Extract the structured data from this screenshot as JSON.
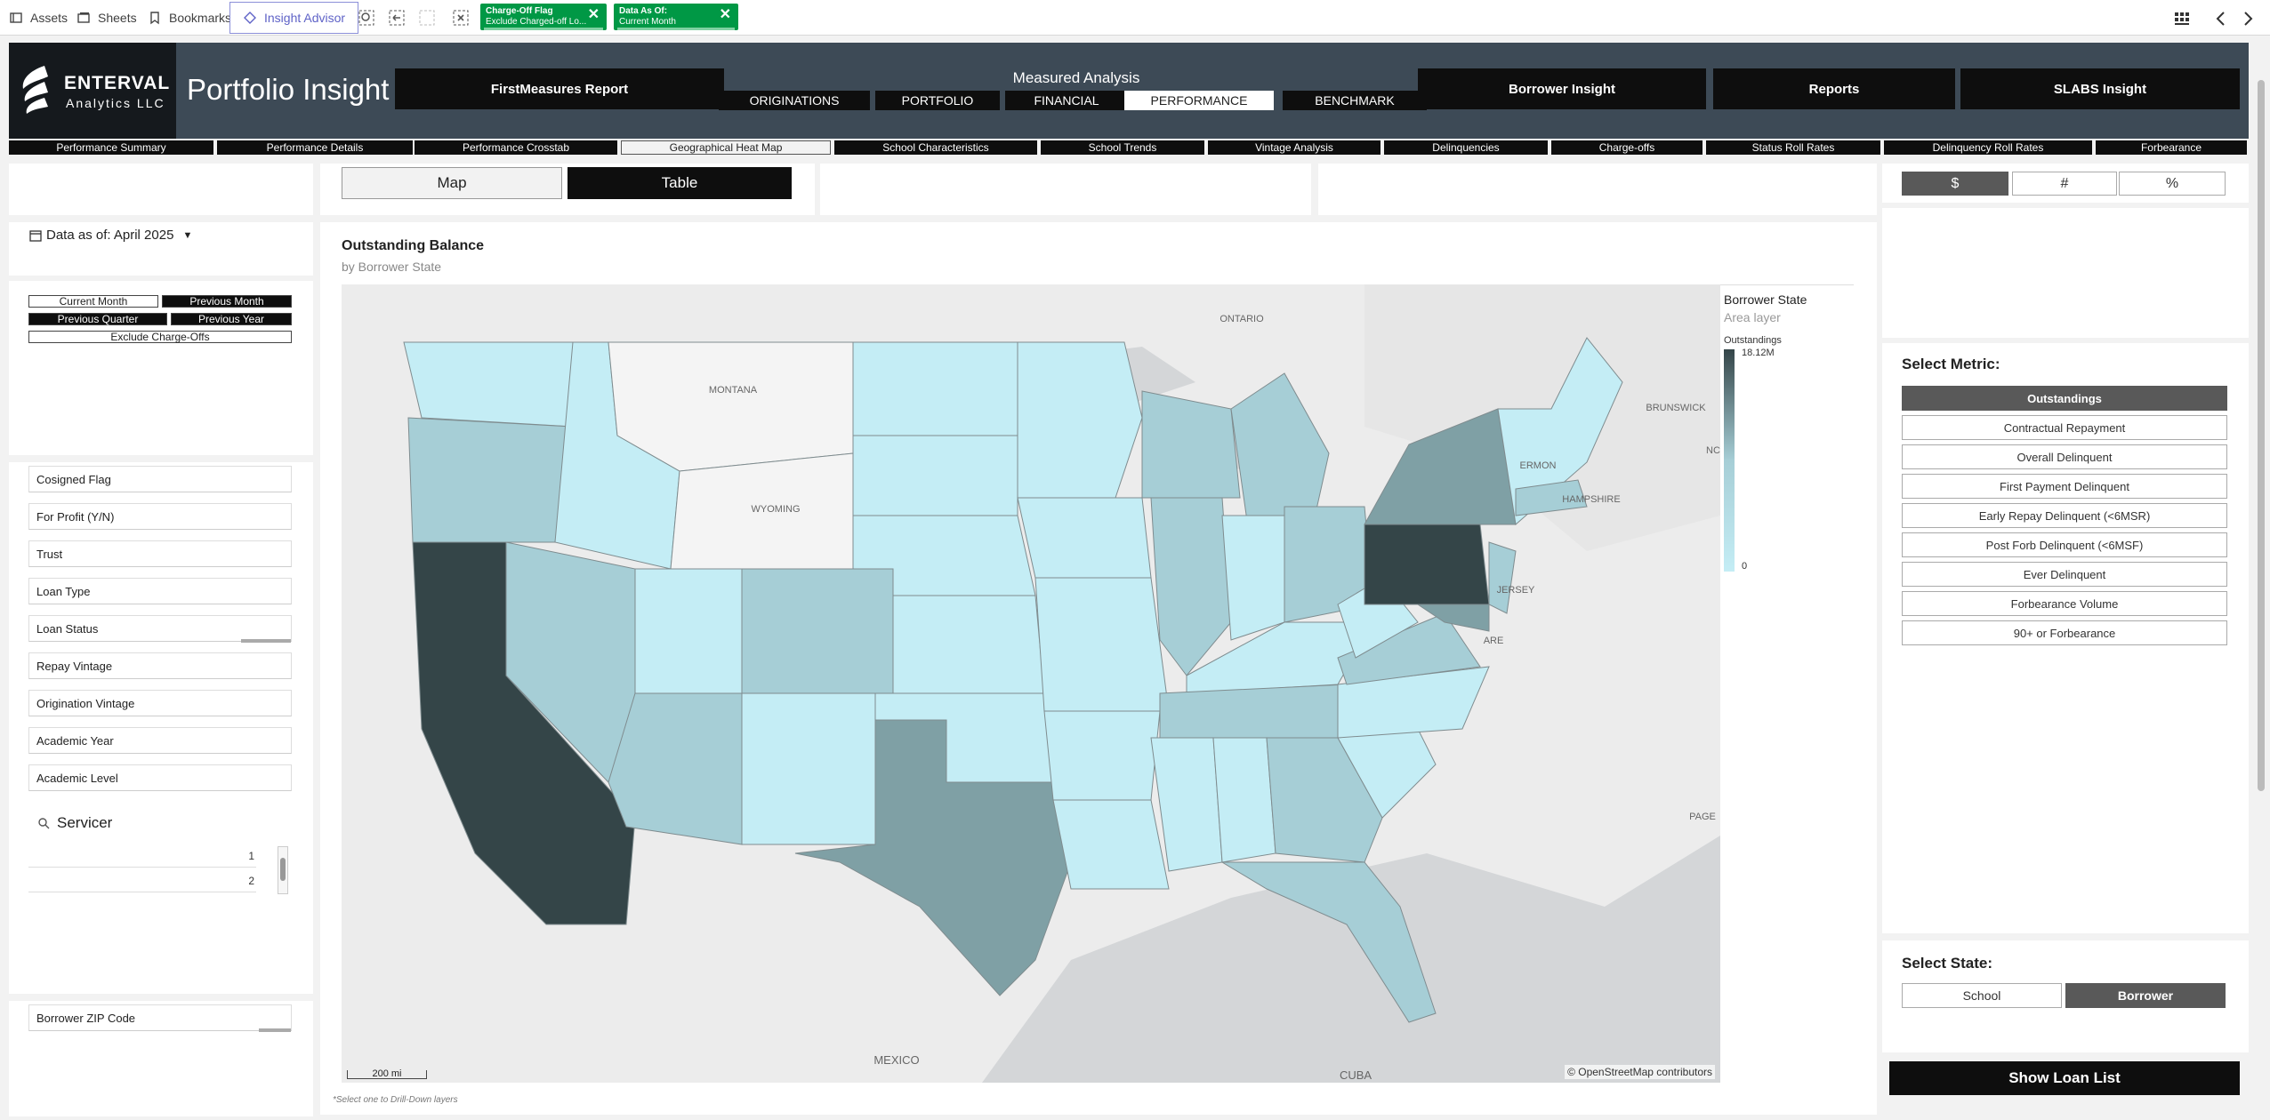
{
  "toolbar": {
    "assets": "Assets",
    "sheets": "Sheets",
    "bookmarks": "Bookmarks",
    "insight_advisor": "Insight Advisor"
  },
  "selections": [
    {
      "field": "Charge-Off Flag",
      "value": "Exclude Charged-off Lo..."
    },
    {
      "field": "Data As Of:",
      "value": "Current Month"
    }
  ],
  "header": {
    "logo_name": "ENTERVAL",
    "logo_sub": "Analytics LLC",
    "app_title": "Portfolio Insight",
    "firstmeasures": "FirstMeasures Report",
    "measured_analysis": "Measured Analysis",
    "measured_tabs": [
      "ORIGINATIONS",
      "PORTFOLIO",
      "FINANCIAL",
      "PERFORMANCE",
      "BENCHMARK"
    ],
    "active_measured_tab": "PERFORMANCE",
    "borrower_insight": "Borrower Insight",
    "reports": "Reports",
    "slabs_insight": "SLABS Insight"
  },
  "subnav": {
    "tabs": [
      "Performance Summary",
      "Performance Details",
      "Performance Crosstab",
      "Geographical Heat Map",
      "School Characteristics",
      "School Trends",
      "Vintage Analysis",
      "Delinquencies",
      "Charge-offs",
      "Status Roll Rates",
      "Delinquency Roll Rates",
      "Forbearance"
    ],
    "active": "Geographical Heat Map"
  },
  "view_toggle": {
    "map": "Map",
    "table": "Table",
    "active": "Table"
  },
  "units": {
    "options": [
      "$",
      "#",
      "%"
    ],
    "active": "$"
  },
  "left": {
    "data_asof": "Data as of: April 2025",
    "period_buttons": [
      {
        "label": "Current Month",
        "selected": false
      },
      {
        "label": "Previous Month",
        "selected": true
      },
      {
        "label": "Previous Quarter",
        "selected": true
      },
      {
        "label": "Previous Year",
        "selected": true
      },
      {
        "label": "Exclude Charge-Offs",
        "selected": false
      }
    ],
    "filters": [
      "Cosigned Flag",
      "For Profit (Y/N)",
      "Trust",
      "Loan Type",
      "Loan Status",
      "Repay Vintage",
      "Origination Vintage",
      "Academic Year",
      "Academic Level"
    ],
    "servicer_title": "Servicer",
    "servicer_values": [
      "1",
      "2"
    ],
    "zip_filter": "Borrower ZIP Code"
  },
  "map": {
    "title": "Outstanding Balance",
    "subtitle": "by Borrower State",
    "footnote": "*Select one to Drill-Down layers",
    "attribution": "© OpenStreetMap contributors",
    "scale": "200 mi",
    "basemap_labels": [
      "ONTARIO",
      "MONTANA",
      "WYOMING",
      "MEXICO",
      "CUBA",
      "BRUNSWICK",
      "ERMON",
      "HAMPSHIRE",
      "JERSEY",
      "ARE",
      "PAGE",
      "NC"
    ],
    "legend_title": "Borrower State",
    "legend_sub": "Area layer",
    "legend_field": "Outstandings",
    "legend_max": "18.12M",
    "legend_min": "0",
    "colors": {
      "darkest": "#344548",
      "dark": "#7fa0a5",
      "mid": "#a6ced6",
      "light": "#c4edf5",
      "nodata": "#f4f4f4",
      "land": "#ececec",
      "water": "#d4d6d8"
    }
  },
  "right": {
    "select_metric": "Select Metric:",
    "metrics": [
      "Outstandings",
      "Contractual Repayment",
      "Overall Delinquent",
      "First Payment Delinquent",
      "Early Repay Delinquent (<6MSR)",
      "Post Forb Delinquent (<6MSF)",
      "Ever Delinquent",
      "Forbearance Volume",
      "90+ or Forbearance"
    ],
    "active_metric": "Outstandings",
    "select_state": "Select State:",
    "state_options": [
      "School",
      "Borrower"
    ],
    "active_state": "Borrower",
    "show_loan_list": "Show Loan List"
  }
}
